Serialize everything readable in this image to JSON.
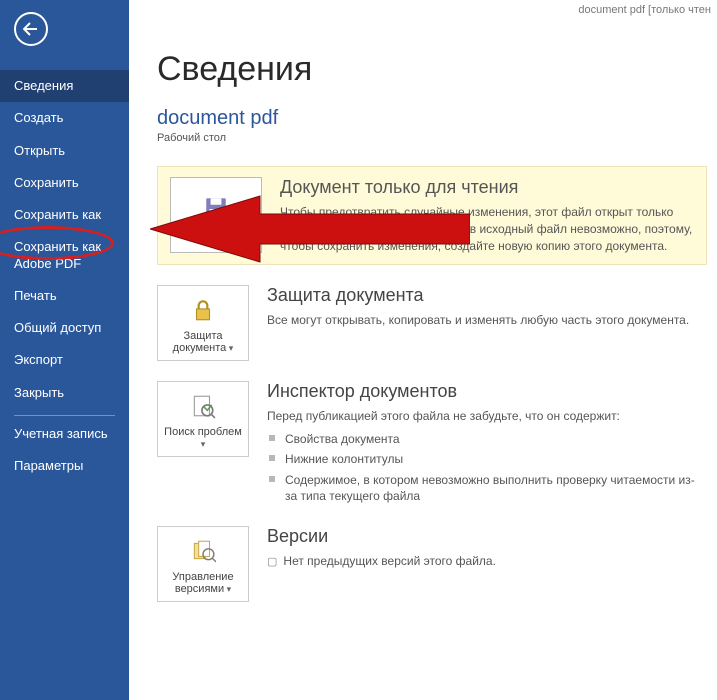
{
  "titlebar": "document pdf [только чтен",
  "page": {
    "title": "Сведения",
    "doc_title": "document pdf",
    "location": "Рабочий стол"
  },
  "sidebar": {
    "items": [
      "Сведения",
      "Создать",
      "Открыть",
      "Сохранить",
      "Сохранить как",
      "Сохранить как Adobe PDF",
      "Печать",
      "Общий доступ",
      "Экспорт",
      "Закрыть"
    ],
    "itemsB": [
      "Учетная запись",
      "Параметры"
    ]
  },
  "banner": {
    "tile_label": "Сохранить как",
    "heading": "Документ только для чтения",
    "body": "Чтобы предотвратить случайные изменения, этот файл открыт только для чтения. Внесение изменений в исходный файл невозможно, поэтому, чтобы сохранить изменения, создайте новую копию этого документа."
  },
  "protect": {
    "tile_label": "Защита документа",
    "heading": "Защита документа",
    "body": "Все могут открывать, копировать и изменять любую часть этого документа."
  },
  "inspect": {
    "tile_label": "Поиск проблем",
    "heading": "Инспектор документов",
    "lead": "Перед публикацией этого файла не забудьте, что он содержит:",
    "items": [
      "Свойства документа",
      "Нижние колонтитулы",
      "Содержимое, в котором невозможно выполнить проверку читаемости из-за типа текущего файла"
    ]
  },
  "versions": {
    "tile_label": "Управление версиями",
    "heading": "Версии",
    "body": "Нет предыдущих версий этого файла."
  }
}
